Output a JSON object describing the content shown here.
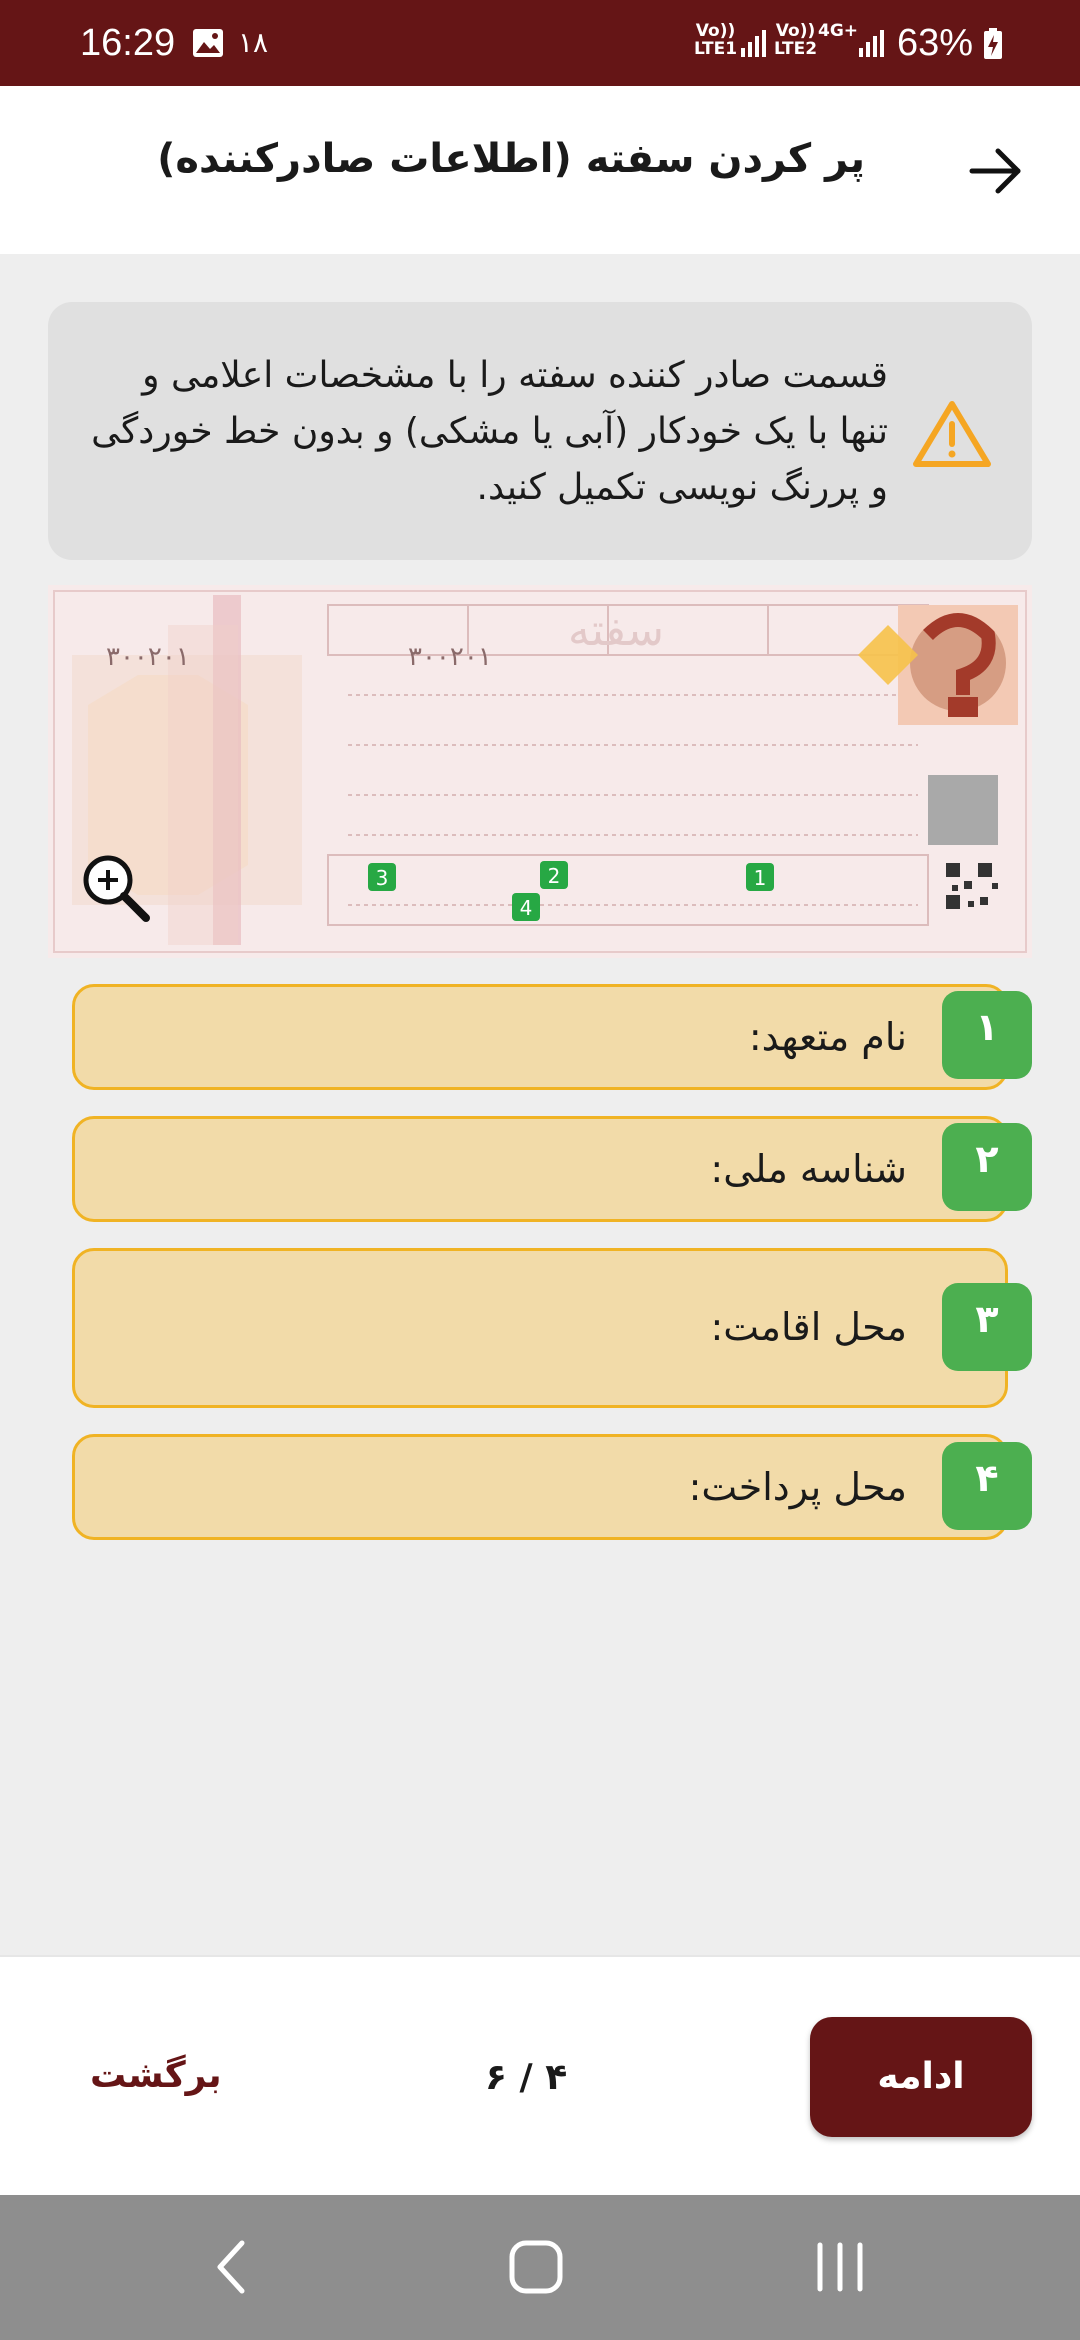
{
  "status_bar": {
    "time": "16:29",
    "notification_count": "۱۸",
    "sim1_label": "Vo))\nLTE1",
    "sim2_label": "Vo))\nLTE2",
    "network": "4G+",
    "battery": "63%"
  },
  "app_bar": {
    "title": "پر کردن سفته (اطلاعات صادرکننده)",
    "back_icon": "arrow-right-icon"
  },
  "warning": {
    "text": "قسمت صادر کننده سفته را با مشخصات اعلامی و تنها با یک خودکار (آبی یا مشکی) و بدون خط خوردگی و پررنگ نویسی تکمیل کنید.",
    "icon": "warning-triangle-icon",
    "color": "#f5a623"
  },
  "cheque_image": {
    "title_text": "سفته",
    "serial": "۳۰۰۲۰۱",
    "markers": [
      "1",
      "2",
      "3",
      "4"
    ],
    "zoom_icon": "zoom-in-icon"
  },
  "fields": [
    {
      "number": "۱",
      "label": "نام متعهد:"
    },
    {
      "number": "۲",
      "label": "شناسه ملی:"
    },
    {
      "number": "۳",
      "label": "محل اقامت:"
    },
    {
      "number": "۴",
      "label": "محل پرداخت:"
    }
  ],
  "footer": {
    "continue_label": "ادامه",
    "pager": "۴ / ۶",
    "back_label": "برگشت"
  },
  "colors": {
    "brand": "#651516",
    "field_bg": "#f2dba9",
    "field_border": "#f0b324",
    "badge": "#4caf50"
  },
  "nav_bar": {
    "back": "nav-back-icon",
    "home": "nav-home-icon",
    "recents": "nav-recents-icon"
  }
}
